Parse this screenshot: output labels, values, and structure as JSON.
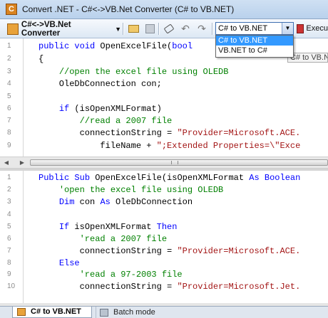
{
  "window": {
    "title": "Convert .NET - C#<->VB.Net Converter (C# to VB.NET)"
  },
  "toolbar": {
    "converter_label": "C#<->VB.Net Converter",
    "conversion_selected": "C# to VB.NET",
    "conversion_options": [
      "C# to VB.NET",
      "VB.NET to C#"
    ],
    "execute_label": "Execu",
    "tooltip_text": "C# to VB.NE"
  },
  "source_pane": {
    "line_numbers": [
      "1",
      "2",
      "3",
      "4",
      "5",
      "6",
      "7",
      "8",
      "9"
    ],
    "lines": [
      "public void OpenExcelFile(bool",
      "{",
      "    //open the excel file using OLEDB",
      "    OleDbConnection con;",
      "",
      "    if (isOpenXMLFormat)",
      "        //read a 2007 file",
      "        connectionString = \"Provider=Microsoft.ACE.",
      "            fileName + \";Extended Properties=\\\"Exce"
    ]
  },
  "result_pane": {
    "line_numbers": [
      "1",
      "2",
      "3",
      "4",
      "5",
      "6",
      "7",
      "8",
      "9",
      "10"
    ],
    "lines": [
      "Public Sub OpenExcelFile(isOpenXMLFormat As Boolean",
      "    'open the excel file using OLEDB",
      "    Dim con As OleDbConnection",
      "",
      "    If isOpenXMLFormat Then",
      "        'read a 2007 file",
      "        connectionString = \"Provider=Microsoft.ACE.",
      "    Else",
      "        'read a 97-2003 file",
      "        connectionString = \"Provider=Microsoft.Jet."
    ]
  },
  "tabs": [
    {
      "label": "C# to VB.NET",
      "active": true
    },
    {
      "label": "Batch mode",
      "active": false
    }
  ],
  "icons": [
    "app-icon",
    "converter-icon",
    "open-folder-icon",
    "save-icon",
    "clear-icon",
    "undo-icon",
    "redo-icon",
    "execute-icon",
    "tab-converter-icon",
    "batch-mode-icon"
  ]
}
